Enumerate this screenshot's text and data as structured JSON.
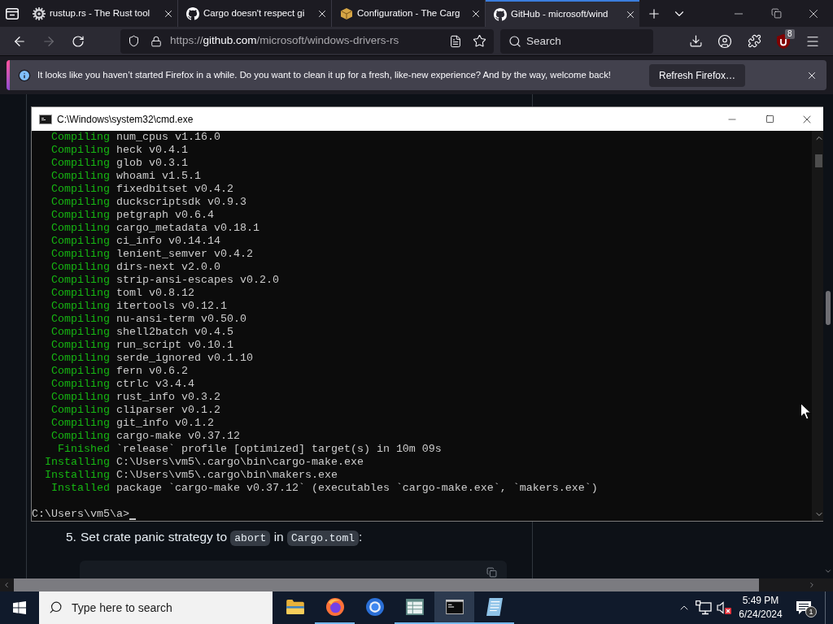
{
  "browser_tabs": [
    {
      "title": "rustup.rs - The Rust tool",
      "selected": false
    },
    {
      "title": "Cargo doesn't respect gi",
      "selected": false
    },
    {
      "title": "Configuration - The Carg",
      "selected": false
    },
    {
      "title": "GitHub - microsoft/wind",
      "selected": true
    }
  ],
  "navigation": {
    "back": {
      "disabled": false
    },
    "forward": {
      "disabled": true
    },
    "url": {
      "scheme": "https://",
      "host": "github.com",
      "path": "/microsoft/windows-drivers-rs"
    },
    "search": {
      "placeholder": "Search"
    },
    "extension_badge": "8"
  },
  "notification": {
    "message": "It looks like you haven’t started Firefox in a while. Do you want to clean it up for a fresh, like-new experience? And by the way, welcome back!",
    "button": "Refresh Firefox…"
  },
  "terminal": {
    "title": "C:\\Windows\\system32\\cmd.exe",
    "lines": [
      {
        "status": "Compiling",
        "text": "num_cpus v1.16.0"
      },
      {
        "status": "Compiling",
        "text": "heck v0.4.1"
      },
      {
        "status": "Compiling",
        "text": "glob v0.3.1"
      },
      {
        "status": "Compiling",
        "text": "whoami v1.5.1"
      },
      {
        "status": "Compiling",
        "text": "fixedbitset v0.4.2"
      },
      {
        "status": "Compiling",
        "text": "duckscriptsdk v0.9.3"
      },
      {
        "status": "Compiling",
        "text": "petgraph v0.6.4"
      },
      {
        "status": "Compiling",
        "text": "cargo_metadata v0.18.1"
      },
      {
        "status": "Compiling",
        "text": "ci_info v0.14.14"
      },
      {
        "status": "Compiling",
        "text": "lenient_semver v0.4.2"
      },
      {
        "status": "Compiling",
        "text": "dirs-next v2.0.0"
      },
      {
        "status": "Compiling",
        "text": "strip-ansi-escapes v0.2.0"
      },
      {
        "status": "Compiling",
        "text": "toml v0.8.12"
      },
      {
        "status": "Compiling",
        "text": "itertools v0.12.1"
      },
      {
        "status": "Compiling",
        "text": "nu-ansi-term v0.50.0"
      },
      {
        "status": "Compiling",
        "text": "shell2batch v0.4.5"
      },
      {
        "status": "Compiling",
        "text": "run_script v0.10.1"
      },
      {
        "status": "Compiling",
        "text": "serde_ignored v0.1.10"
      },
      {
        "status": "Compiling",
        "text": "fern v0.6.2"
      },
      {
        "status": "Compiling",
        "text": "ctrlc v3.4.4"
      },
      {
        "status": "Compiling",
        "text": "rust_info v0.3.2"
      },
      {
        "status": "Compiling",
        "text": "cliparser v0.1.2"
      },
      {
        "status": "Compiling",
        "text": "git_info v0.1.2"
      },
      {
        "status": "Compiling",
        "text": "cargo-make v0.37.12"
      },
      {
        "status": "Finished",
        "text": "`release` profile [optimized] target(s) in 10m 09s"
      },
      {
        "status": "Installing",
        "text": "C:\\Users\\vm5\\.cargo\\bin\\cargo-make.exe"
      },
      {
        "status": "Installing",
        "text": "C:\\Users\\vm5\\.cargo\\bin\\makers.exe"
      },
      {
        "status": "Installed",
        "text": "package `cargo-make v0.37.12` (executables `cargo-make.exe`, `makers.exe`)"
      }
    ],
    "prompt": "C:\\Users\\vm5\\a>"
  },
  "page": {
    "step_number": "5.",
    "segments": [
      {
        "kind": "text",
        "text": "Set crate panic strategy to "
      },
      {
        "kind": "code",
        "text": "abort"
      },
      {
        "kind": "text",
        "text": " in "
      },
      {
        "kind": "code",
        "text": "Cargo.toml"
      },
      {
        "kind": "text",
        "text": ":"
      }
    ]
  },
  "taskbar": {
    "search": {
      "placeholder": "Type here to search"
    },
    "apps": [
      {
        "running": false,
        "selected": false
      },
      {
        "running": true,
        "selected": false
      },
      {
        "running": false,
        "selected": false
      },
      {
        "running": true,
        "selected": false
      },
      {
        "running": true,
        "selected": true
      },
      {
        "running": true,
        "selected": false
      }
    ],
    "time": "5:49 PM",
    "date": "6/24/2024",
    "notification_count": "1"
  }
}
